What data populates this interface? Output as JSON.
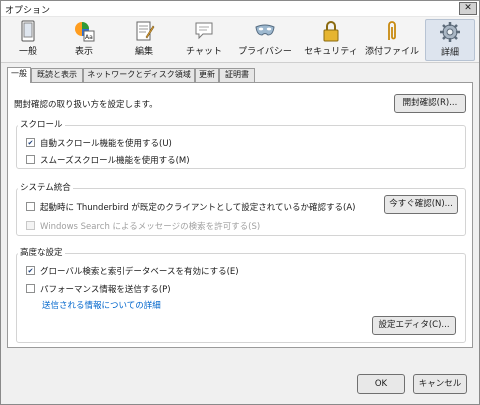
{
  "window": {
    "title": "オプション",
    "close_glyph": "✕"
  },
  "toolbar": {
    "panes": [
      {
        "label": "一般",
        "icon": "general-icon"
      },
      {
        "label": "表示",
        "icon": "display-icon"
      },
      {
        "label": "編集",
        "icon": "compose-icon"
      },
      {
        "label": "チャット",
        "icon": "chat-icon"
      },
      {
        "label": "プライバシー",
        "icon": "privacy-mask-icon"
      },
      {
        "label": "セキュリティ",
        "icon": "security-lock-icon"
      },
      {
        "label": "添付ファイル",
        "icon": "attachment-clip-icon"
      },
      {
        "label": "詳細",
        "icon": "advanced-gear-icon",
        "selected": true
      }
    ]
  },
  "tabs": [
    "一般",
    "既読と表示",
    "ネットワークとディスク領域",
    "更新",
    "証明書"
  ],
  "general": {
    "receipt_text": "開封確認の取り扱い方を設定します。",
    "receipt_button": "開封確認(R)...",
    "scroll": {
      "label": "スクロール",
      "auto_scroll": {
        "label": "自動スクロール機能を使用する(U)",
        "checked": true
      },
      "smooth_scroll": {
        "label": "スムーズスクロール機能を使用する(M)",
        "checked": false
      }
    },
    "system": {
      "label": "システム統合",
      "default_client": {
        "label": "起動時に Thunderbird が既定のクライアントとして設定されているか確認する(A)",
        "checked": false
      },
      "check_now_button": "今すぐ確認(N)...",
      "windows_search": {
        "label": "Windows Search によるメッセージの検索を許可する(S)",
        "checked": false,
        "disabled": true
      }
    },
    "advanced": {
      "label": "高度な設定",
      "global_search": {
        "label": "グローバル検索と索引データベースを有効にする(E)",
        "checked": true
      },
      "performance": {
        "label": "パフォーマンス情報を送信する(P)",
        "checked": false
      },
      "info_link": "送信される情報についての詳細",
      "config_editor_button": "設定エディタ(C)..."
    }
  },
  "buttons": {
    "ok": "OK",
    "cancel": "キャンセル"
  },
  "colors": {
    "link": "#0066cc",
    "check": "#1b3f7a",
    "selected_pane": "#dde4ee"
  }
}
